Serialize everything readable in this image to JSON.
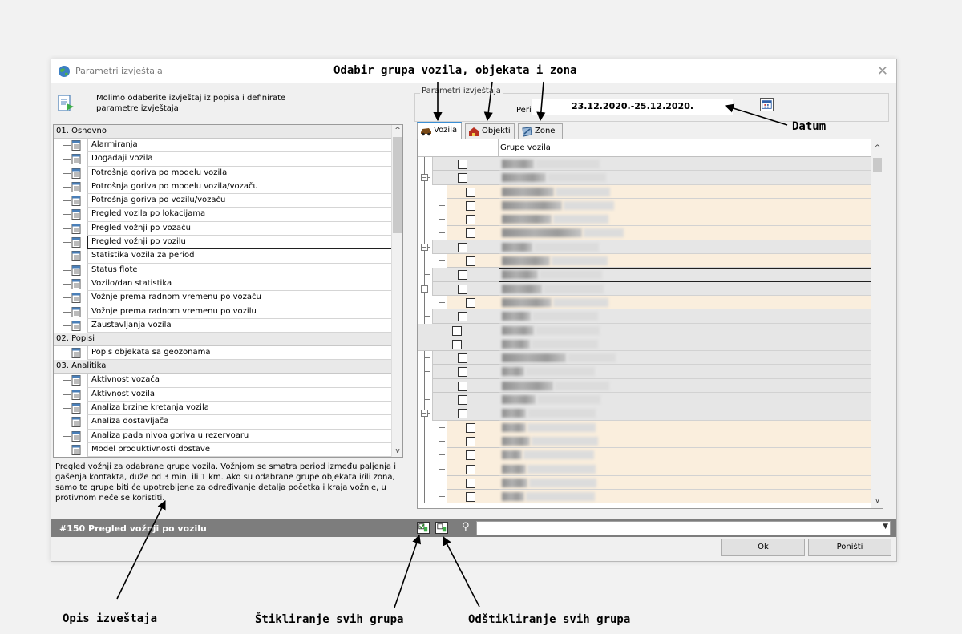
{
  "dialog": {
    "title": "Parametri izvještaja",
    "close_glyph": "✕",
    "intro": "Molimo odaberite izvještaj iz popisa i definirate parametre izvještaja"
  },
  "report_list": {
    "categories": [
      {
        "label": "01. Osnovno",
        "items": [
          "Alarmiranja",
          "Događaji vozila",
          "Potrošnja goriva po modelu vozila",
          "Potrošnja goriva po modelu vozila/vozaču",
          "Potrošnja goriva po vozilu/vozaču",
          "Pregled vozila po lokacijama",
          "Pregled vožnji po vozaču",
          "Pregled vožnji po vozilu",
          "Statistika vozila za period",
          "Status flote",
          "Vozilo/dan statistika",
          "Vožnje prema radnom vremenu po vozaču",
          "Vožnje prema radnom vremenu po vozilu",
          "Zaustavljanja vozila"
        ]
      },
      {
        "label": "02. Popisi",
        "items": [
          "Popis objekata sa geozonama"
        ]
      },
      {
        "label": "03. Analitika",
        "items": [
          "Aktivnost vozača",
          "Aktivnost vozila",
          "Analiza brzine kretanja vozila",
          "Analiza dostavljača",
          "Analiza pada nivoa goriva u rezervoaru",
          "Model produktivnosti dostave"
        ]
      }
    ],
    "selected": "Pregled vožnji po vozilu"
  },
  "description": "Pregled vožnji za odabrane grupe vozila. Vožnjom se smatra period između paljenja i gašenja kontakta, duže od 3 min. ili 1 km. Ako su odabrane grupe objekata i/ili zona, samo te grupe biti će upotrebljene za određivanje detalja početka i kraja vožnje, u protivnom neće se koristiti.",
  "params": {
    "legend": "Parametri izvještaja",
    "period_label": "Period",
    "period_value": "23.12.2020.-25.12.2020.",
    "tabs": [
      {
        "label": "Vozila",
        "active": true,
        "icon": "car-icon"
      },
      {
        "label": "Objekti",
        "active": false,
        "icon": "building-icon"
      },
      {
        "label": "Zone",
        "active": false,
        "icon": "zone-icon"
      }
    ],
    "grid_header": "Grupe vozila"
  },
  "status": {
    "text": "#150 Pregled vožnji po vozilu",
    "search_value": ""
  },
  "buttons": {
    "ok": "Ok",
    "cancel": "Poništi"
  },
  "annotations": {
    "top": "Odabir grupa vozila, objekata i zona",
    "date": "Datum",
    "desc": "Opis izveštaja",
    "check_all": "Štikliranje svih grupa",
    "uncheck_all": "Odštikliranje svih grupa"
  },
  "colors": {
    "row_gray": "#e6e6e6",
    "row_beige": "#faeedd",
    "status_strip": "#7d7d7d",
    "tab_accent": "#3a8fd6"
  }
}
